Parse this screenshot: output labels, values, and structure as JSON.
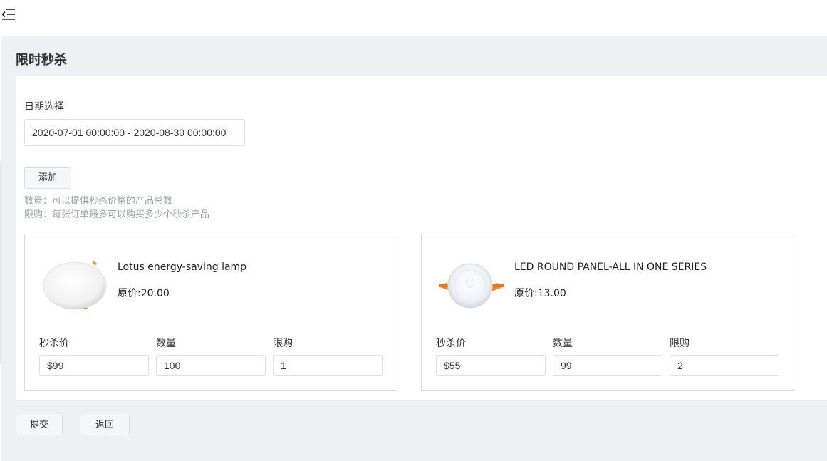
{
  "page": {
    "title": "限时秒杀"
  },
  "form": {
    "date_label": "日期选择",
    "date_range": "2020-07-01 00:00:00 - 2020-08-30 00:00:00",
    "add_button": "添加",
    "hint_quantity": "数量：可以提供秒杀价格的产品总数",
    "hint_limit": "限购：每张订单最多可以购买多少个秒杀产品"
  },
  "products": [
    {
      "name": "Lotus energy-saving lamp",
      "original_price": "原价:20.00",
      "fields": {
        "flash_price_label": "秒杀价",
        "flash_price": "$99",
        "quantity_label": "数量",
        "quantity": "100",
        "limit_label": "限购",
        "limit": "1"
      }
    },
    {
      "name": "LED ROUND PANEL-ALL IN ONE SERIES",
      "original_price": "原价:13.00",
      "fields": {
        "flash_price_label": "秒杀价",
        "flash_price": "$55",
        "quantity_label": "数量",
        "quantity": "99",
        "limit_label": "限购",
        "limit": "2"
      }
    }
  ],
  "actions": {
    "submit": "提交",
    "back": "返回"
  },
  "colors": {
    "background": "#eef0f4",
    "panel": "#ffffff",
    "hint_text": "#a0a4aa",
    "accent_orange": "#f0882a"
  },
  "icons": {
    "menu_toggle": "menu-fold-icon"
  }
}
